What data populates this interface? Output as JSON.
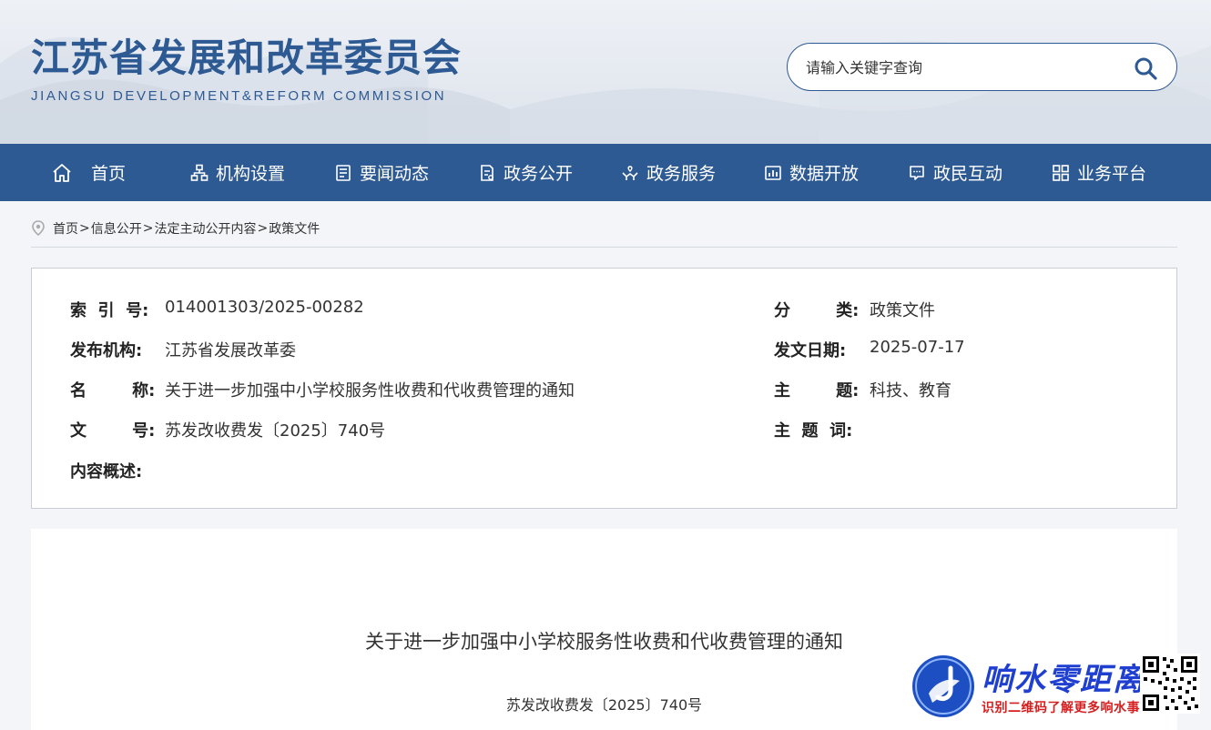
{
  "header": {
    "title": "江苏省发展和改革委员会",
    "subtitle": "JIANGSU DEVELOPMENT&REFORM COMMISSION",
    "search_placeholder": "请输入关键字查询"
  },
  "nav": {
    "items": [
      {
        "label": "首页",
        "icon": "home-icon"
      },
      {
        "label": "机构设置",
        "icon": "org-chart-icon"
      },
      {
        "label": "要闻动态",
        "icon": "news-icon"
      },
      {
        "label": "政务公开",
        "icon": "document-icon"
      },
      {
        "label": "政务服务",
        "icon": "hands-service-icon"
      },
      {
        "label": "数据开放",
        "icon": "chart-icon"
      },
      {
        "label": "政民互动",
        "icon": "chat-icon"
      },
      {
        "label": "业务平台",
        "icon": "grid-icon"
      }
    ]
  },
  "breadcrumb": {
    "items": [
      "首页",
      "信息公开",
      "法定主动公开内容",
      "政策文件"
    ],
    "separator": ">"
  },
  "meta": {
    "index_label": "索  引  号:",
    "index_value": "014001303/2025-00282",
    "category_label": "分        类:",
    "category_value": "政策文件",
    "publisher_label": "发布机构:",
    "publisher_value": "江苏省发展改革委",
    "date_label": "发文日期:",
    "date_value": "2025-07-17",
    "name_label": "名        称:",
    "name_value": "关于进一步加强中小学校服务性收费和代收费管理的通知",
    "topic_label": "主        题:",
    "topic_value": "科技、教育",
    "docno_label": "文        号:",
    "docno_value": "苏发改收费发〔2025〕740号",
    "keywords_label": "主  题  词:",
    "keywords_value": "",
    "summary_label": "内容概述:",
    "summary_value": ""
  },
  "content": {
    "title": "关于进一步加强中小学校服务性收费和代收费管理的通知",
    "doc_number": "苏发改收费发〔2025〕740号"
  },
  "watermark": {
    "name": "响水零距离",
    "sub": "识别二维码了解更多响水事"
  },
  "colors": {
    "brand": "#2e5a93",
    "watermark_blue": "#1e3fd0",
    "watermark_red": "#d42020"
  }
}
